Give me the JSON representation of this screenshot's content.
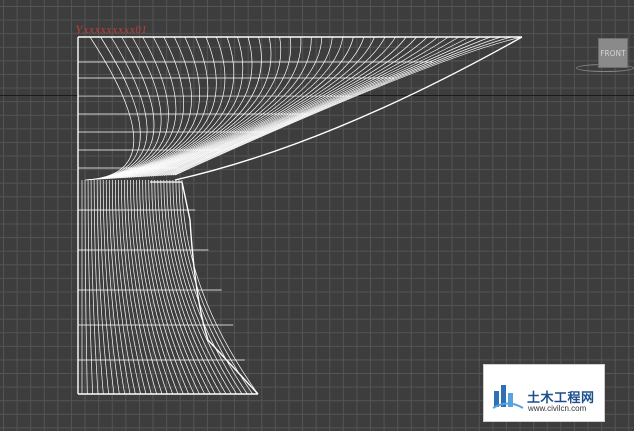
{
  "viewport": {
    "object_label": "Yxxxxxxxxx01",
    "view_cube_label": "FRONT",
    "grid_color": "#545454",
    "background_color": "#3d3d3d",
    "wire_color": "#ffffff"
  },
  "watermark": {
    "title": "土木工程网",
    "url": "www.civilcn.com",
    "brand_color": "#1f4e8c"
  }
}
